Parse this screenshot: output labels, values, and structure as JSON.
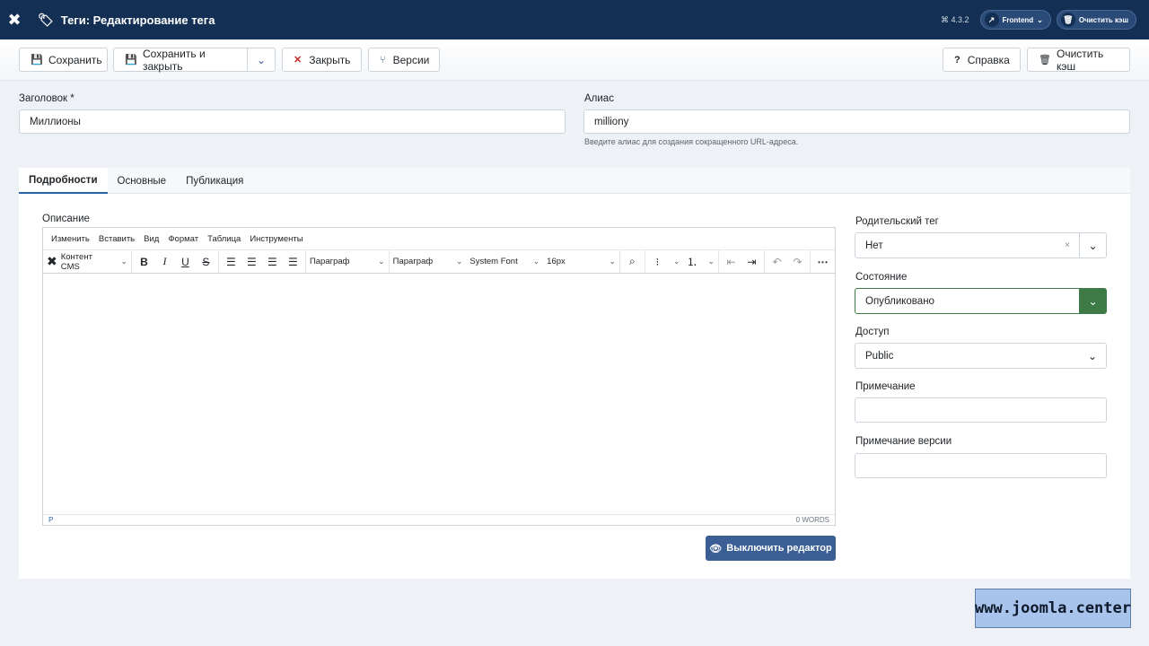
{
  "header": {
    "title": "Теги: Редактирование тега",
    "version": "4.3.2",
    "frontend_label": "Frontend",
    "clear_cache_label": "Очистить кэш"
  },
  "toolbar": {
    "save": "Сохранить",
    "save_close": "Сохранить и закрыть",
    "close": "Закрыть",
    "versions": "Версии",
    "help": "Справка",
    "clear_cache": "Очистить кэш"
  },
  "form": {
    "title_label": "Заголовок *",
    "title_value": "Миллионы",
    "alias_label": "Алиас",
    "alias_value": "milliony",
    "alias_hint": "Введите алиас для создания сокращенного URL-адреса."
  },
  "tabs": [
    {
      "label": "Подробности",
      "active": true
    },
    {
      "label": "Основные",
      "active": false
    },
    {
      "label": "Публикация",
      "active": false
    }
  ],
  "editor": {
    "label": "Описание",
    "menu": [
      "Изменить",
      "Вставить",
      "Вид",
      "Формат",
      "Таблица",
      "Инструменты"
    ],
    "cms_content": "Контент CMS",
    "block_format_1": "Параграф",
    "block_format_2": "Параграф",
    "font": "System Font",
    "size": "16px",
    "status_path": "P",
    "word_count": "0 WORDS",
    "toggle_button": "Выключить редактор"
  },
  "sidebar": {
    "parent_label": "Родительский тег",
    "parent_value": "Нет",
    "state_label": "Состояние",
    "state_value": "Опубликовано",
    "access_label": "Доступ",
    "access_value": "Public",
    "note_label": "Примечание",
    "version_note_label": "Примечание версии"
  },
  "colors": {
    "header_bg": "#132f53",
    "published_green": "#3d7a45",
    "primary_button": "#3b5f94"
  },
  "watermark": "www.joomla.center"
}
